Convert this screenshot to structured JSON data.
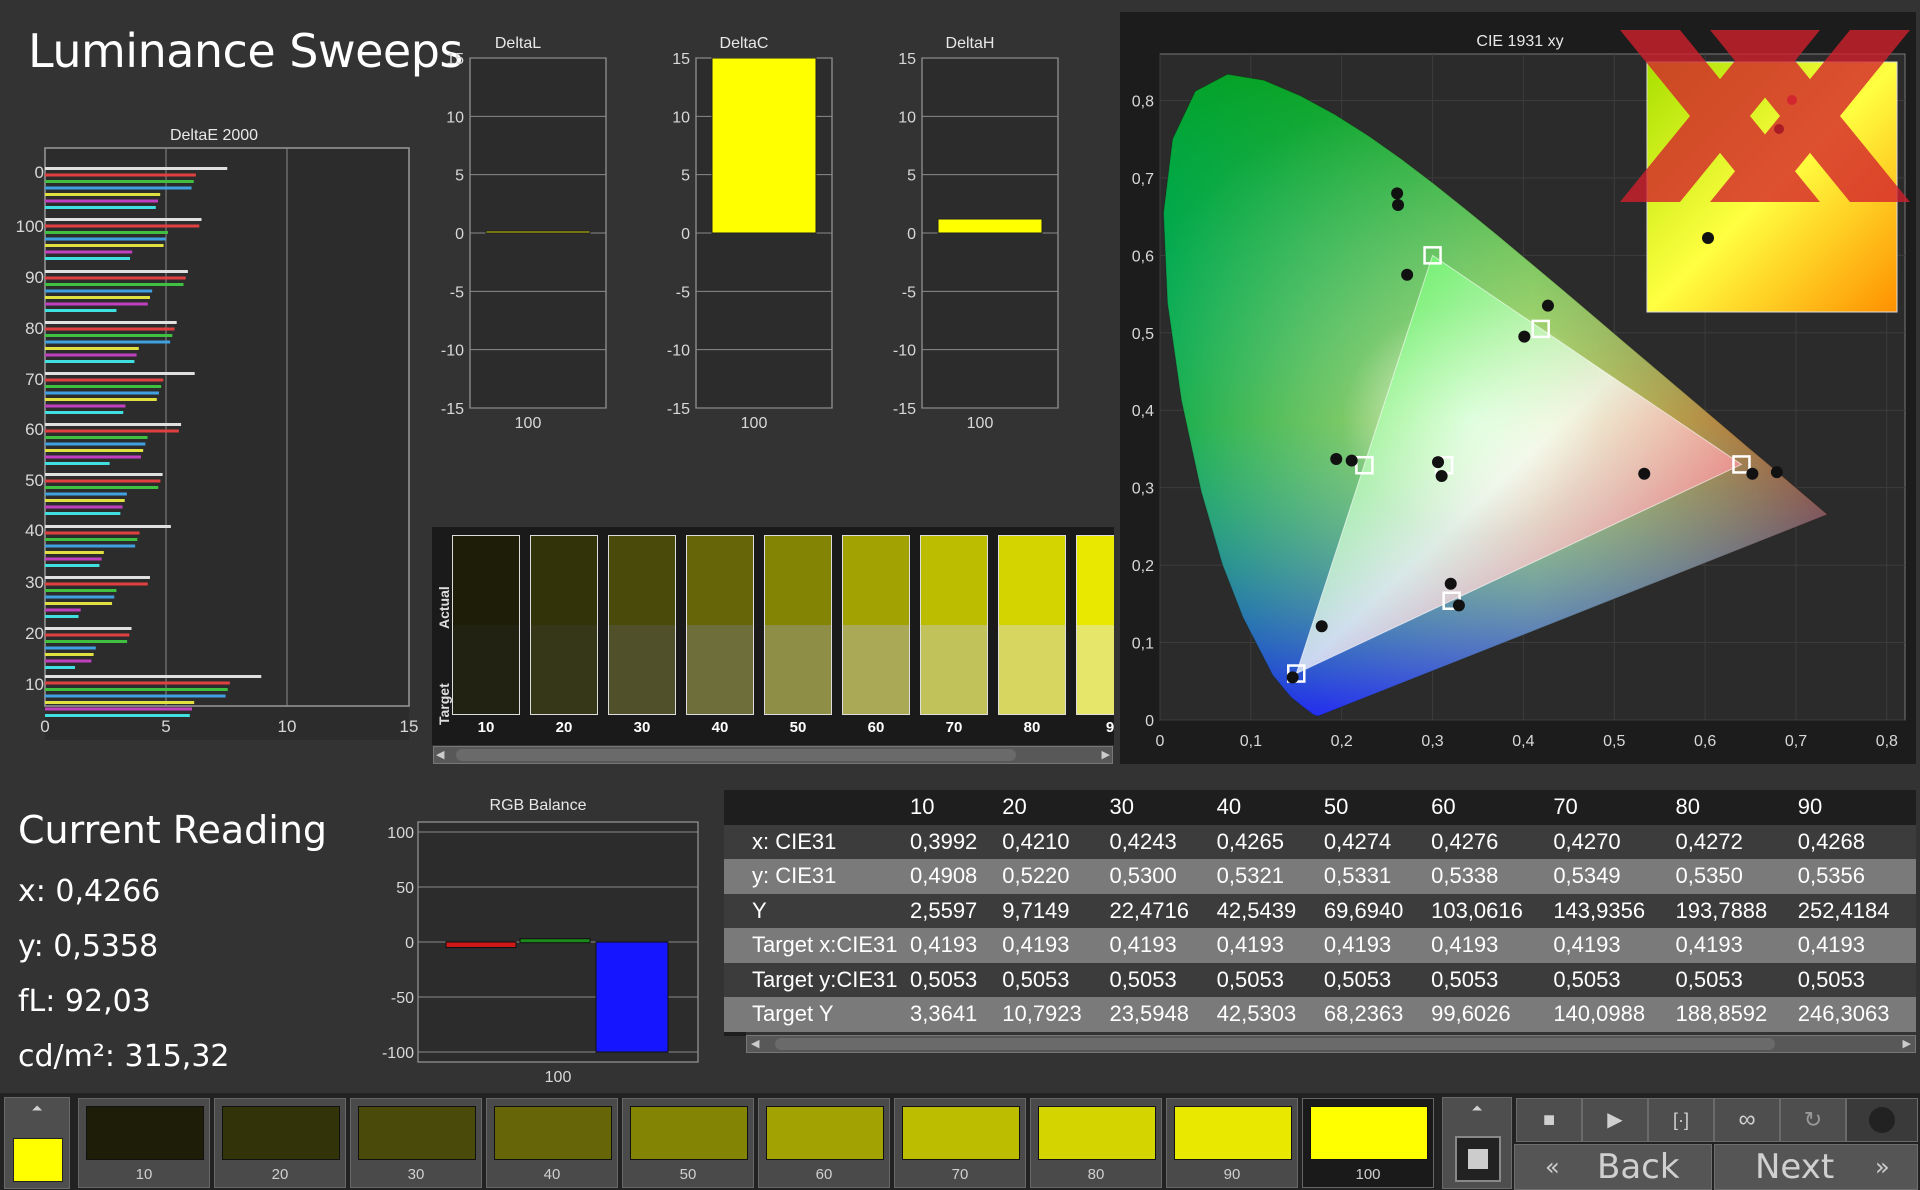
{
  "header": {
    "title": "Luminance Sweeps"
  },
  "charts": {
    "deltae": {
      "title": "DeltaE 2000",
      "x_ticks": [
        "0",
        "5",
        "10",
        "15"
      ],
      "y_ticks": [
        "0",
        "100",
        "90",
        "80",
        "70",
        "60",
        "50",
        "40",
        "30",
        "20",
        "10"
      ]
    },
    "delta_small": [
      {
        "title": "DeltaL",
        "category": "100",
        "value": 0.1,
        "color": "#c8c800"
      },
      {
        "title": "DeltaC",
        "category": "100",
        "value": 15,
        "color": "#ffff00"
      },
      {
        "title": "DeltaH",
        "category": "100",
        "value": 1.2,
        "color": "#ffff00"
      }
    ],
    "delta_y_ticks": [
      "15",
      "10",
      "5",
      "0",
      "-5",
      "-10",
      "-15"
    ],
    "rgb_balance": {
      "title": "RGB Balance",
      "category": "100",
      "y_ticks": [
        "100",
        "50",
        "0",
        "-50",
        "-100"
      ],
      "values": [
        {
          "name": "red",
          "value": -5,
          "color": "#d01818"
        },
        {
          "name": "green",
          "value": 3,
          "color": "#1a8a1a"
        },
        {
          "name": "blue",
          "value": -100,
          "color": "#1515ff"
        }
      ]
    },
    "cie": {
      "title": "CIE 1931 xy",
      "x_ticks": [
        "0",
        "0,1",
        "0,2",
        "0,3",
        "0,4",
        "0,5",
        "0,6",
        "0,7",
        "0,8"
      ],
      "y_ticks": [
        "0",
        "0,1",
        "0,2",
        "0,3",
        "0,4",
        "0,5",
        "0,6",
        "0,7",
        "0,8"
      ]
    }
  },
  "swatches": {
    "row_labels": {
      "actual": "Actual",
      "target": "Target"
    },
    "items": [
      {
        "label": "10",
        "actual": "#1e1e08",
        "target": "#222212"
      },
      {
        "label": "20",
        "actual": "#33330a",
        "target": "#363618"
      },
      {
        "label": "30",
        "actual": "#4a4a0a",
        "target": "#50502a"
      },
      {
        "label": "40",
        "actual": "#666608",
        "target": "#6e6e3a"
      },
      {
        "label": "50",
        "actual": "#848404",
        "target": "#8e8e46"
      },
      {
        "label": "60",
        "actual": "#a2a202",
        "target": "#aaaa56"
      },
      {
        "label": "70",
        "actual": "#bcbc00",
        "target": "#c2c25a"
      },
      {
        "label": "80",
        "actual": "#d4d400",
        "target": "#d6d660"
      },
      {
        "label": "9",
        "actual": "#e8e800",
        "target": "#e6e66a"
      }
    ]
  },
  "current_reading": {
    "title": "Current Reading",
    "x": "x: 0,4266",
    "y": "y: 0,5358",
    "fl": "fL: 92,03",
    "cdm2": "cd/m²: 315,32"
  },
  "readings_table": {
    "columns": [
      "10",
      "20",
      "30",
      "40",
      "50",
      "60",
      "70",
      "80",
      "90"
    ],
    "rows": [
      {
        "label": "x: CIE31",
        "values": [
          "0,3992",
          "0,4210",
          "0,4243",
          "0,4265",
          "0,4274",
          "0,4276",
          "0,4270",
          "0,4272",
          "0,4268"
        ]
      },
      {
        "label": "y: CIE31",
        "values": [
          "0,4908",
          "0,5220",
          "0,5300",
          "0,5321",
          "0,5331",
          "0,5338",
          "0,5349",
          "0,5350",
          "0,5356"
        ]
      },
      {
        "label": "Y",
        "values": [
          "2,5597",
          "9,7149",
          "22,4716",
          "42,5439",
          "69,6940",
          "103,0616",
          "143,9356",
          "193,7888",
          "252,4184"
        ]
      },
      {
        "label": "Target x:CIE31",
        "values": [
          "0,4193",
          "0,4193",
          "0,4193",
          "0,4193",
          "0,4193",
          "0,4193",
          "0,4193",
          "0,4193",
          "0,4193"
        ]
      },
      {
        "label": "Target y:CIE31",
        "values": [
          "0,5053",
          "0,5053",
          "0,5053",
          "0,5053",
          "0,5053",
          "0,5053",
          "0,5053",
          "0,5053",
          "0,5053"
        ]
      },
      {
        "label": "Target Y",
        "values": [
          "3,3641",
          "10,7923",
          "23,5948",
          "42,5303",
          "68,2363",
          "99,6026",
          "140,0988",
          "188,8592",
          "246,3063"
        ]
      }
    ]
  },
  "bottom_tiles": [
    {
      "label": "10",
      "color": "#1e1e08"
    },
    {
      "label": "20",
      "color": "#33330a"
    },
    {
      "label": "30",
      "color": "#4a4a0a"
    },
    {
      "label": "40",
      "color": "#666608"
    },
    {
      "label": "50",
      "color": "#848404"
    },
    {
      "label": "60",
      "color": "#a2a202"
    },
    {
      "label": "70",
      "color": "#bcbc00"
    },
    {
      "label": "80",
      "color": "#d4d400"
    },
    {
      "label": "90",
      "color": "#e8e800"
    },
    {
      "label": "100",
      "color": "#ffff00"
    }
  ],
  "nav": {
    "back": "Back",
    "next": "Next"
  },
  "chart_data": [
    {
      "type": "bar",
      "title": "DeltaL",
      "categories": [
        "100"
      ],
      "values": [
        0.1
      ],
      "ylim": [
        -15,
        15
      ]
    },
    {
      "type": "bar",
      "title": "DeltaC",
      "categories": [
        "100"
      ],
      "values": [
        15
      ],
      "ylim": [
        -15,
        15
      ]
    },
    {
      "type": "bar",
      "title": "DeltaH",
      "categories": [
        "100"
      ],
      "values": [
        1.2
      ],
      "ylim": [
        -15,
        15
      ]
    },
    {
      "type": "bar",
      "title": "RGB Balance",
      "categories": [
        "100"
      ],
      "series": [
        {
          "values": [
            -5
          ]
        },
        {
          "values": [
            3
          ]
        },
        {
          "values": [
            -100
          ]
        }
      ],
      "ylim": [
        -100,
        100
      ]
    }
  ]
}
